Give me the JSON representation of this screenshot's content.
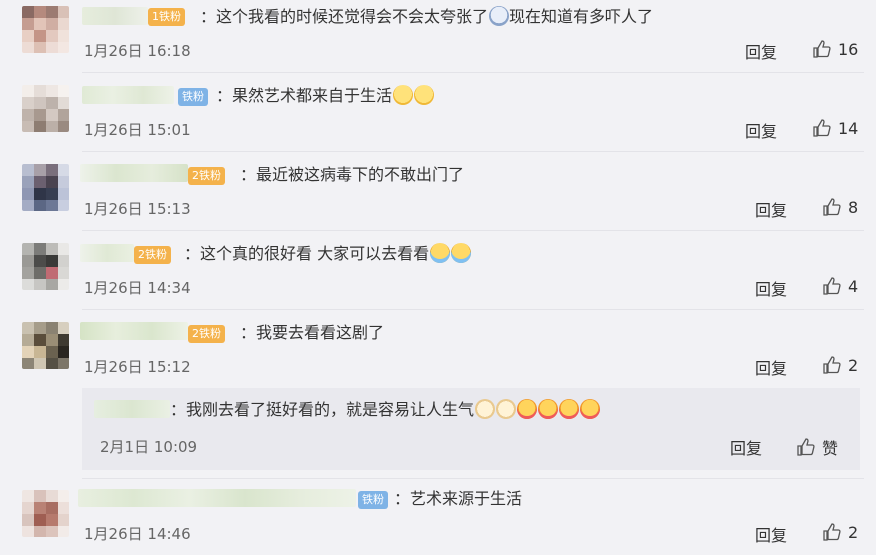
{
  "comments": [
    {
      "badge": "1铁粉",
      "badge_type": "gold",
      "text": "：这个我看的时候还觉得会不会太夸张了",
      "emojis_mid": [
        "scared"
      ],
      "text2": "现在知道有多吓人了",
      "time": "1月26日 16:18",
      "reply": "回复",
      "likes": "16"
    },
    {
      "badge": "铁粉",
      "badge_type": "blue",
      "text": "：果然艺术都来自于生活",
      "emojis": [
        "laugh",
        "laugh"
      ],
      "time": "1月26日 15:01",
      "reply": "回复",
      "likes": "14"
    },
    {
      "badge": "2铁粉",
      "badge_type": "gold",
      "text": "：最近被这病毒下的不敢出门了",
      "time": "1月26日 15:13",
      "reply": "回复",
      "likes": "8"
    },
    {
      "badge": "2铁粉",
      "badge_type": "gold",
      "text": "：这个真的很好看 大家可以去看看",
      "emojis": [
        "cry",
        "cry"
      ],
      "time": "1月26日 14:34",
      "reply": "回复",
      "likes": "4"
    },
    {
      "badge": "2铁粉",
      "badge_type": "gold",
      "text": "：我要去看看这剧了",
      "time": "1月26日 15:12",
      "reply": "回复",
      "likes": "2"
    },
    {
      "badge": "铁粉",
      "badge_type": "blue",
      "text": "：艺术来源于生活",
      "time": "1月26日 14:46",
      "reply": "回复",
      "likes": "2"
    }
  ],
  "subreply": {
    "text": "：我刚去看了挺好看的，就是容易让人生气",
    "emojis": [
      "dog",
      "dog",
      "yum",
      "yum",
      "yum",
      "yum"
    ],
    "time": "2月1日 10:09",
    "reply": "回复",
    "likes": "赞"
  }
}
